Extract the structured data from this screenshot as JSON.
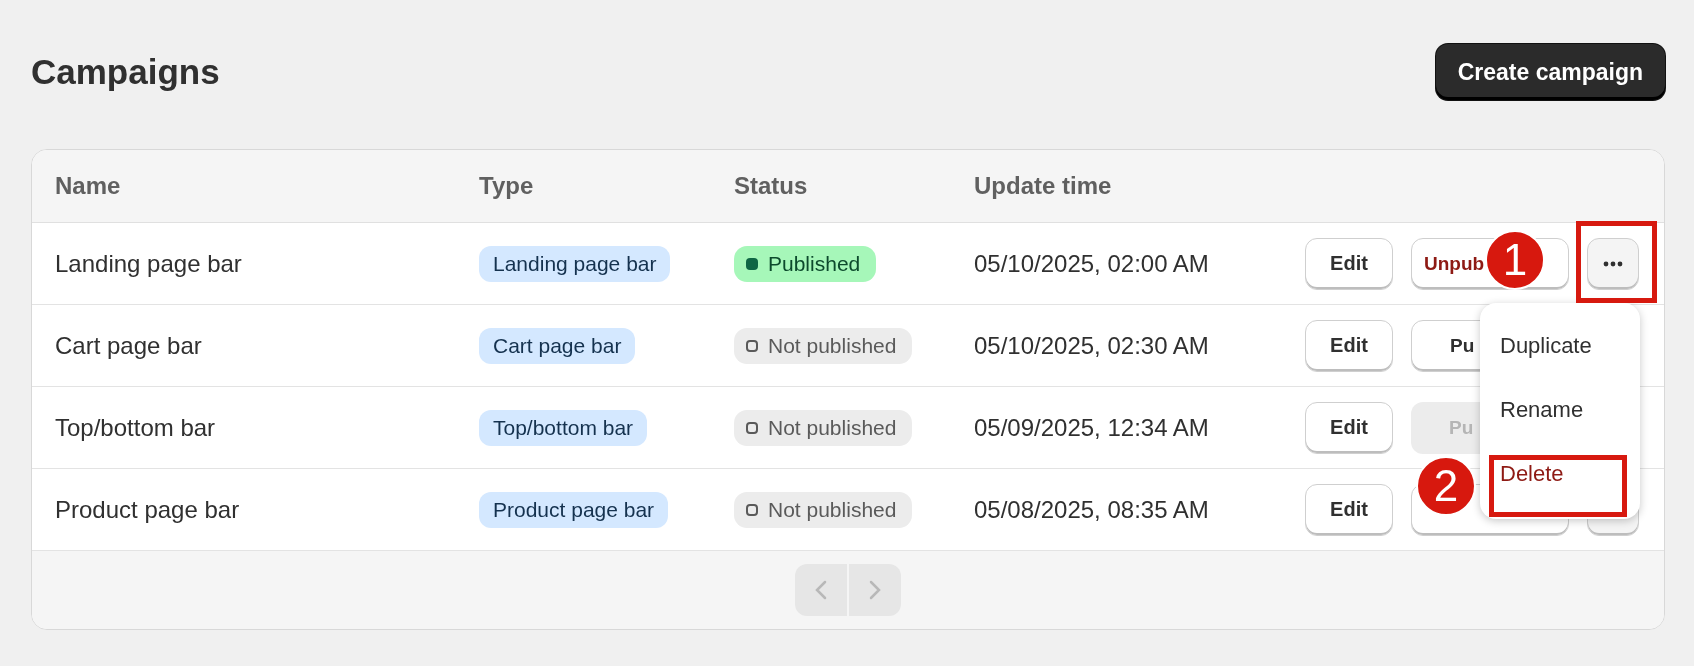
{
  "page": {
    "title": "Campaigns",
    "primary_action": "Create campaign"
  },
  "table": {
    "columns": [
      "Name",
      "Type",
      "Status",
      "Update time"
    ],
    "rows": [
      {
        "name": "Landing page bar",
        "type": "Landing page bar",
        "status": {
          "kind": "published",
          "label": "Published"
        },
        "update_time": "05/10/2025, 02:00 AM",
        "edit": "Edit",
        "toggle": {
          "kind": "unpublish",
          "label": "Unpub",
          "disabled": false
        },
        "more_button": {
          "kind": "full"
        }
      },
      {
        "name": "Cart page bar",
        "type": "Cart page bar",
        "status": {
          "kind": "draft",
          "label": "Not published"
        },
        "update_time": "05/10/2025, 02:30 AM",
        "edit": "Edit",
        "toggle": {
          "kind": "publish",
          "label": "Pu",
          "disabled": false
        }
      },
      {
        "name": "Top/bottom bar",
        "type": "Top/bottom bar",
        "status": {
          "kind": "draft",
          "label": "Not published"
        },
        "update_time": "05/09/2025, 12:34 AM",
        "edit": "Edit",
        "toggle": {
          "kind": "publish",
          "label": "Pu",
          "disabled": true
        }
      },
      {
        "name": "Product page bar",
        "type": "Product page bar",
        "status": {
          "kind": "draft",
          "label": "Not published"
        },
        "update_time": "05/08/2025, 08:35 AM",
        "edit": "Edit",
        "toggle": {
          "kind": "publish",
          "disabled": false
        },
        "more_button": {
          "kind": "partial"
        }
      }
    ]
  },
  "pagination": {
    "previous_disabled": true,
    "next_disabled": true
  },
  "menu": {
    "items": [
      {
        "label": "Duplicate",
        "kind": "normal"
      },
      {
        "label": "Rename",
        "kind": "normal"
      },
      {
        "label": "Delete",
        "kind": "destructive"
      }
    ]
  },
  "annotations": [
    {
      "number": "1"
    },
    {
      "number": "2"
    }
  ]
}
